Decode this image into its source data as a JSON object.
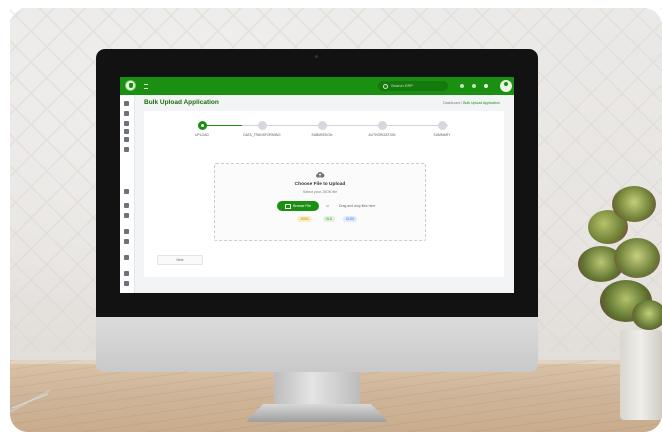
{
  "app": {
    "title": "Bulk Upload Application",
    "breadcrumb": {
      "root": "Dashboard",
      "separator": "/",
      "current": "Bulk Upload Application"
    },
    "brand_color": "#1a8f12"
  },
  "topbar": {
    "search_placeholder": "Search ERP",
    "icons": [
      "menu-icon",
      "search-icon",
      "settings-icon",
      "notification-icon",
      "globe-icon",
      "user-avatar-icon"
    ]
  },
  "sidebar": {
    "icons": [
      "grid-icon",
      "grid-icon",
      "doc-icon",
      "doc-icon",
      "doc-icon",
      "list-icon",
      "chart-icon",
      "doc-icon",
      "doc-icon",
      "doc-icon",
      "table-icon",
      "doc-icon",
      "user-icon",
      "list-icon"
    ]
  },
  "stepper": {
    "steps": [
      {
        "label": "UPLOAD",
        "state": "active"
      },
      {
        "label": "DATA_TRANSFORMING",
        "state": "pending"
      },
      {
        "label": "SUBMISSION",
        "state": "pending"
      },
      {
        "label": "AUTHORIZATION",
        "state": "pending"
      },
      {
        "label": "SUMMARY",
        "state": "pending"
      }
    ]
  },
  "upload": {
    "title": "Choose File to Upload",
    "subtitle": "Select your JSON file",
    "choose_button": "Browse File",
    "or_text": "or",
    "drag_text": "Drag and drop files here",
    "formats": [
      "JSON",
      "XLS",
      "XLSX"
    ]
  },
  "footer": {
    "next_button": "Next"
  }
}
